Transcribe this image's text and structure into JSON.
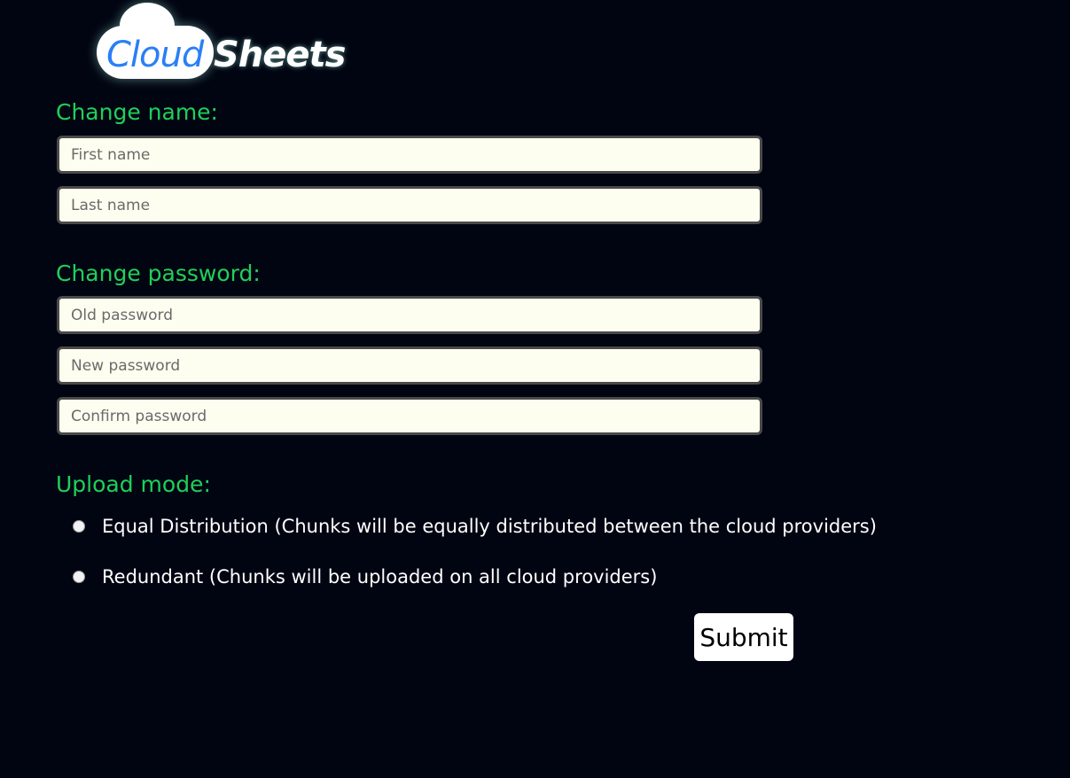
{
  "logo": {
    "cloud_text": "Cloud",
    "sheets_text": "Sheets"
  },
  "name_section": {
    "heading": "Change name:",
    "first_name_placeholder": "First name",
    "last_name_placeholder": "Last name"
  },
  "password_section": {
    "heading": "Change password:",
    "old_password_placeholder": "Old password",
    "new_password_placeholder": "New password",
    "confirm_password_placeholder": "Confirm password"
  },
  "upload_section": {
    "heading": "Upload mode:",
    "options": [
      {
        "label": "Equal Distribution (Chunks will be equally distributed between the cloud providers)",
        "selected": false
      },
      {
        "label": "Redundant (Chunks will be uploaded on all cloud providers)",
        "selected": false
      }
    ]
  },
  "submit_label": "Submit",
  "colors": {
    "background": "#010512",
    "heading_green": "#1fd05a",
    "input_background": "#fefef0",
    "logo_blue": "#2a7ff5"
  }
}
